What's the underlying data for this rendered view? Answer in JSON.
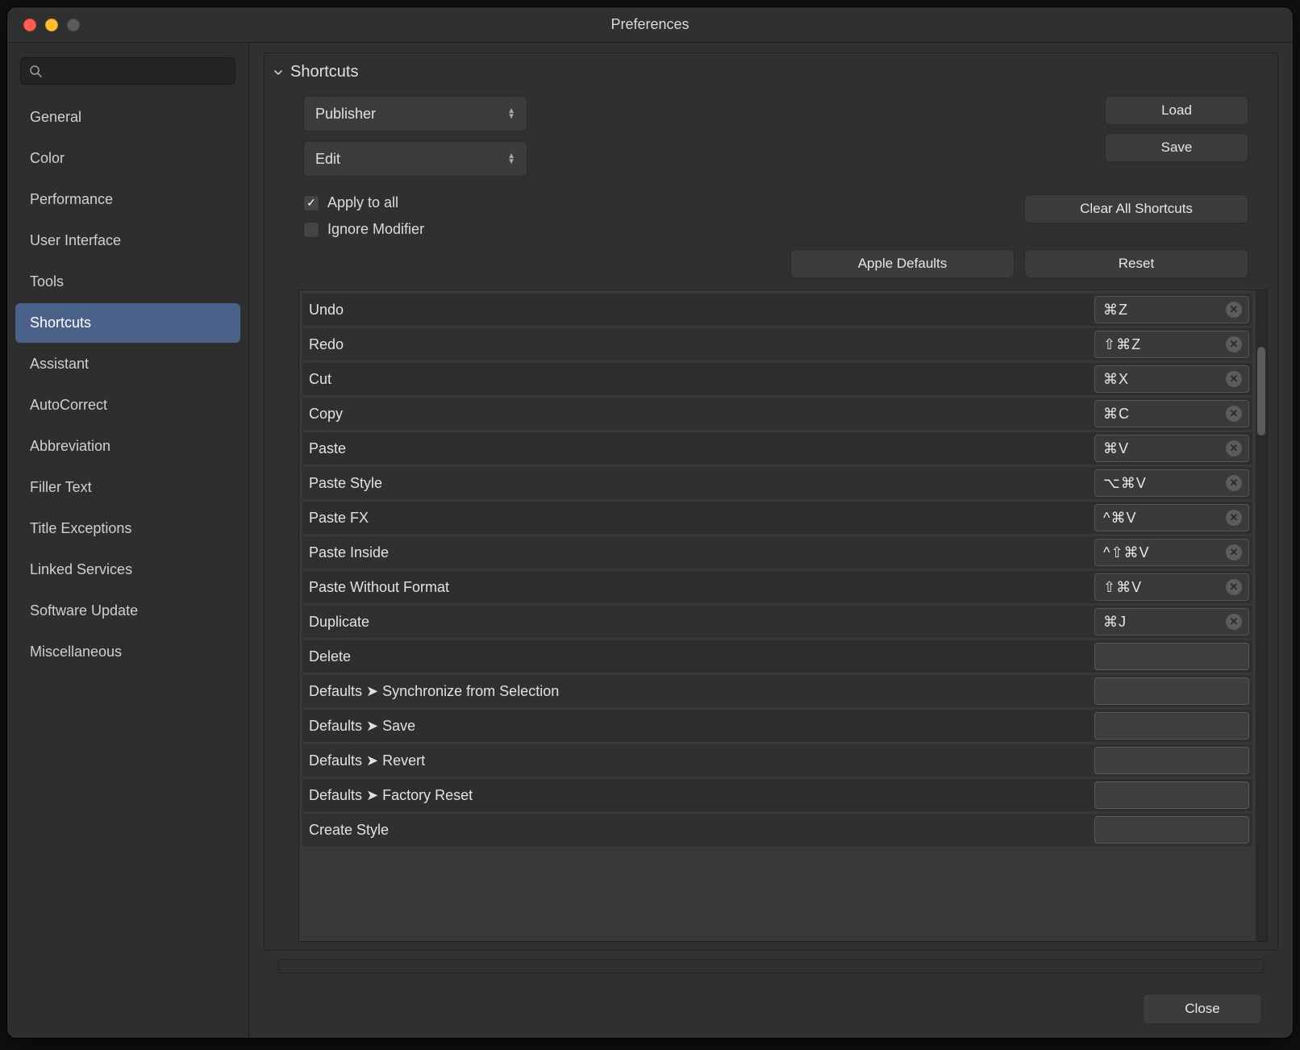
{
  "window": {
    "title": "Preferences"
  },
  "search": {
    "placeholder": ""
  },
  "sidebar": {
    "items": [
      {
        "label": "General"
      },
      {
        "label": "Color"
      },
      {
        "label": "Performance"
      },
      {
        "label": "User Interface"
      },
      {
        "label": "Tools"
      },
      {
        "label": "Shortcuts"
      },
      {
        "label": "Assistant"
      },
      {
        "label": "AutoCorrect"
      },
      {
        "label": "Abbreviation"
      },
      {
        "label": "Filler Text"
      },
      {
        "label": "Title Exceptions"
      },
      {
        "label": "Linked Services"
      },
      {
        "label": "Software Update"
      },
      {
        "label": "Miscellaneous"
      }
    ],
    "selected_index": 5
  },
  "section": {
    "title": "Shortcuts"
  },
  "selects": {
    "app": "Publisher",
    "menu": "Edit"
  },
  "buttons": {
    "load": "Load",
    "save": "Save",
    "clear_all": "Clear All Shortcuts",
    "apple_defaults": "Apple Defaults",
    "reset": "Reset",
    "close": "Close"
  },
  "checkboxes": {
    "apply_to_all": {
      "label": "Apply to all",
      "checked": true
    },
    "ignore_modifier": {
      "label": "Ignore Modifier",
      "checked": false
    }
  },
  "shortcuts": [
    {
      "label": "Undo",
      "key": "⌘Z",
      "has_clear": true
    },
    {
      "label": "Redo",
      "key": "⇧⌘Z",
      "has_clear": true
    },
    {
      "label": "Cut",
      "key": "⌘X",
      "has_clear": true
    },
    {
      "label": "Copy",
      "key": "⌘C",
      "has_clear": true
    },
    {
      "label": "Paste",
      "key": "⌘V",
      "has_clear": true
    },
    {
      "label": "Paste Style",
      "key": "⌥⌘V",
      "has_clear": true
    },
    {
      "label": "Paste FX",
      "key": "^⌘V",
      "has_clear": true
    },
    {
      "label": "Paste Inside",
      "key": "^⇧⌘V",
      "has_clear": true
    },
    {
      "label": "Paste Without Format",
      "key": "⇧⌘V",
      "has_clear": true
    },
    {
      "label": "Duplicate",
      "key": "⌘J",
      "has_clear": true
    },
    {
      "label": "Delete",
      "key": "",
      "has_clear": false
    },
    {
      "label": "Defaults ➤ Synchronize from Selection",
      "key": "",
      "has_clear": false
    },
    {
      "label": "Defaults ➤ Save",
      "key": "",
      "has_clear": false
    },
    {
      "label": "Defaults ➤ Revert",
      "key": "",
      "has_clear": false
    },
    {
      "label": "Defaults ➤ Factory Reset",
      "key": "",
      "has_clear": false
    },
    {
      "label": "Create Style",
      "key": "",
      "has_clear": false
    }
  ]
}
